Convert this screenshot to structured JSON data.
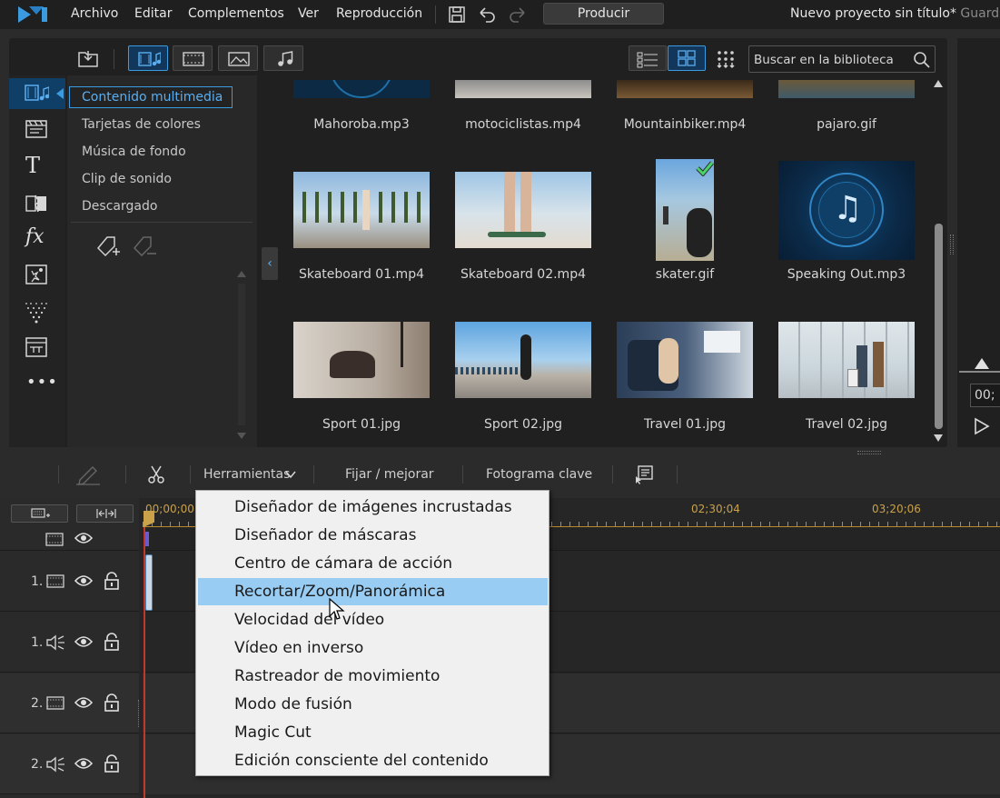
{
  "menubar": {
    "items": [
      "Archivo",
      "Editar",
      "Complementos",
      "Ver",
      "Reproducción"
    ],
    "produce_label": "Producir",
    "project_title": "Nuevo proyecto sin título*",
    "save_status": "Guardad"
  },
  "library": {
    "filters": [
      "import-icon",
      "media-video-audio-filter",
      "video-filter",
      "image-filter",
      "music-filter"
    ],
    "search_placeholder": "Buscar en la biblioteca",
    "tree": [
      "Contenido multimedia",
      "Tarjetas de colores",
      "Música de fondo",
      "Clip de sonido",
      "Descargado"
    ],
    "rail_icons": [
      "media-room-icon",
      "templates-icon",
      "title-icon",
      "transition-icon",
      "fx-icon",
      "pip-icon",
      "particle-icon",
      "subtitle-icon",
      "more-icon"
    ],
    "items": [
      {
        "name": "Mahoroba.mp3",
        "kind": "audio"
      },
      {
        "name": "motociclistas.mp4",
        "kind": "video"
      },
      {
        "name": "Mountainbiker.mp4",
        "kind": "video"
      },
      {
        "name": "pajaro.gif",
        "kind": "image"
      },
      {
        "name": "Skateboard 01.mp4",
        "kind": "video"
      },
      {
        "name": "Skateboard 02.mp4",
        "kind": "video"
      },
      {
        "name": "skater.gif",
        "kind": "image",
        "used": true
      },
      {
        "name": "Speaking Out.mp3",
        "kind": "audio"
      },
      {
        "name": "Sport 01.jpg",
        "kind": "image"
      },
      {
        "name": "Sport 02.jpg",
        "kind": "image"
      },
      {
        "name": "Travel 01.jpg",
        "kind": "image"
      },
      {
        "name": "Travel 02.jpg",
        "kind": "image"
      }
    ]
  },
  "preview": {
    "timecode": "00;"
  },
  "edit_toolbar": {
    "tools_label": "Herramientas",
    "fix_label": "Fijar / mejorar",
    "keyframe_label": "Fotograma clave"
  },
  "timeline": {
    "ruler": [
      "00;00;00",
      "02;30;04",
      "03;20;06"
    ],
    "tracks": [
      {
        "num": "1.",
        "type": "video"
      },
      {
        "num": "1.",
        "type": "audio"
      },
      {
        "num": "2.",
        "type": "video"
      },
      {
        "num": "2.",
        "type": "audio"
      }
    ]
  },
  "tools_menu": {
    "items": [
      "Diseñador de imágenes incrustadas",
      "Diseñador de máscaras",
      "Centro de cámara de acción",
      "Recortar/Zoom/Panorámica",
      "Velocidad del vídeo",
      "Vídeo en inverso",
      "Rastreador de movimiento",
      "Modo de fusión",
      "Magic Cut",
      "Edición consciente del contenido"
    ],
    "selected_index": 3
  },
  "colors": {
    "accent": "#3a9be0",
    "selection": "#99ccf3",
    "ruler": "#c9a24a",
    "playhead": "#c0392b"
  }
}
